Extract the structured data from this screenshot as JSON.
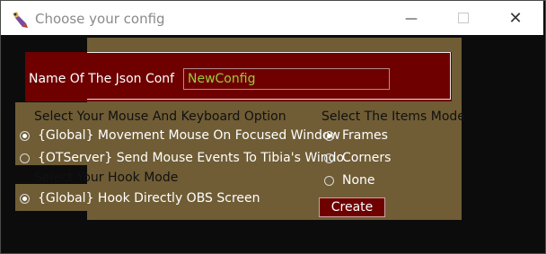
{
  "window": {
    "title": "Choose your config",
    "minimize_glyph": "—",
    "close_glyph": "✕"
  },
  "icons": {
    "app": "app-icon",
    "minimize": "minimize-icon",
    "maximize": "maximize-icon",
    "close": "close-icon"
  },
  "colors": {
    "panel": "#705d35",
    "name_box": "#6e0000",
    "input_text": "#9ccc3d",
    "titlebar": "#ffffff"
  },
  "config_name": {
    "label": "Name Of The Json Conf",
    "value": "NewConfig"
  },
  "mouse_keyboard": {
    "heading": "Select Your Mouse And Keyboard Option",
    "options": [
      {
        "label": "{Global} Movement Mouse On Focused Window",
        "selected": true
      },
      {
        "label": "{OTServer} Send Mouse Events To Tibia's Windo",
        "selected": false
      }
    ]
  },
  "hook": {
    "heading": "Select Your Hook Mode",
    "options": [
      {
        "label": "{Global} Hook Directly OBS Screen",
        "selected": true
      }
    ]
  },
  "items_mode": {
    "heading": "Select The Items Mode",
    "options": [
      {
        "label": "Frames",
        "selected": true
      },
      {
        "label": "Corners",
        "selected": false
      },
      {
        "label": "None",
        "selected": false
      }
    ]
  },
  "create_button": {
    "label": "Create"
  }
}
